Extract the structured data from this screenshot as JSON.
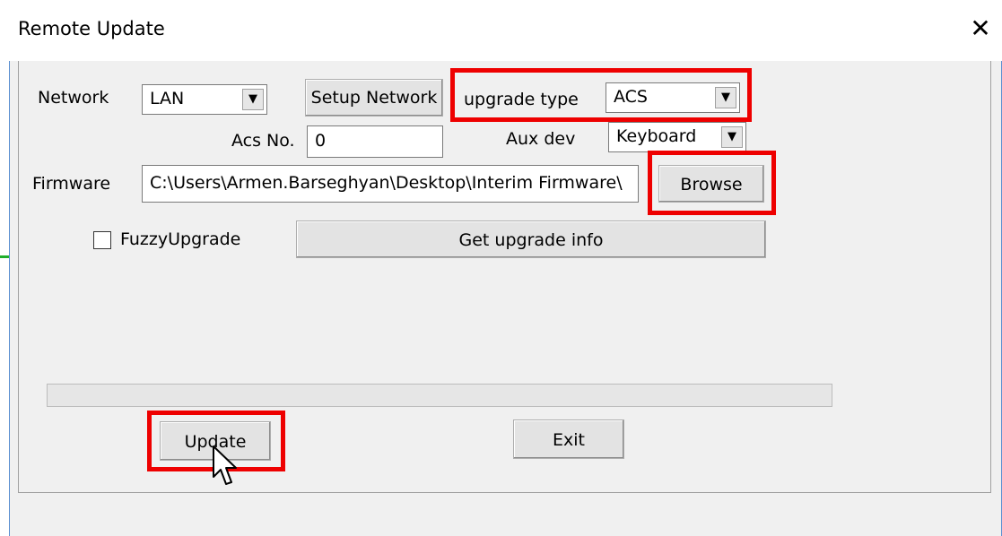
{
  "window": {
    "title": "Remote Update",
    "close_glyph": "✕"
  },
  "network": {
    "label": "Network",
    "value": "LAN"
  },
  "setup_network_label": "Setup Network",
  "upgrade_type": {
    "label": "upgrade type",
    "value": "ACS"
  },
  "acs_no": {
    "label": "Acs No.",
    "value": "0"
  },
  "aux_dev": {
    "label": "Aux dev",
    "value": "Keyboard"
  },
  "firmware": {
    "label": "Firmware",
    "value": "C:\\Users\\Armen.Barseghyan\\Desktop\\Interim Firmware\\"
  },
  "browse_label": "Browse",
  "fuzzy": {
    "label": "FuzzyUpgrade",
    "checked": false
  },
  "get_info_label": "Get upgrade info",
  "progress": {
    "value": 0
  },
  "update_label": "Update",
  "exit_label": "Exit",
  "colors": {
    "highlight": "#ee0000",
    "window_border": "#5b8fd1",
    "dialog_bg": "#f0f0f0"
  },
  "icons": {
    "dropdown": "triangle-down-icon",
    "close": "close-icon",
    "cursor": "mouse-pointer-icon"
  }
}
